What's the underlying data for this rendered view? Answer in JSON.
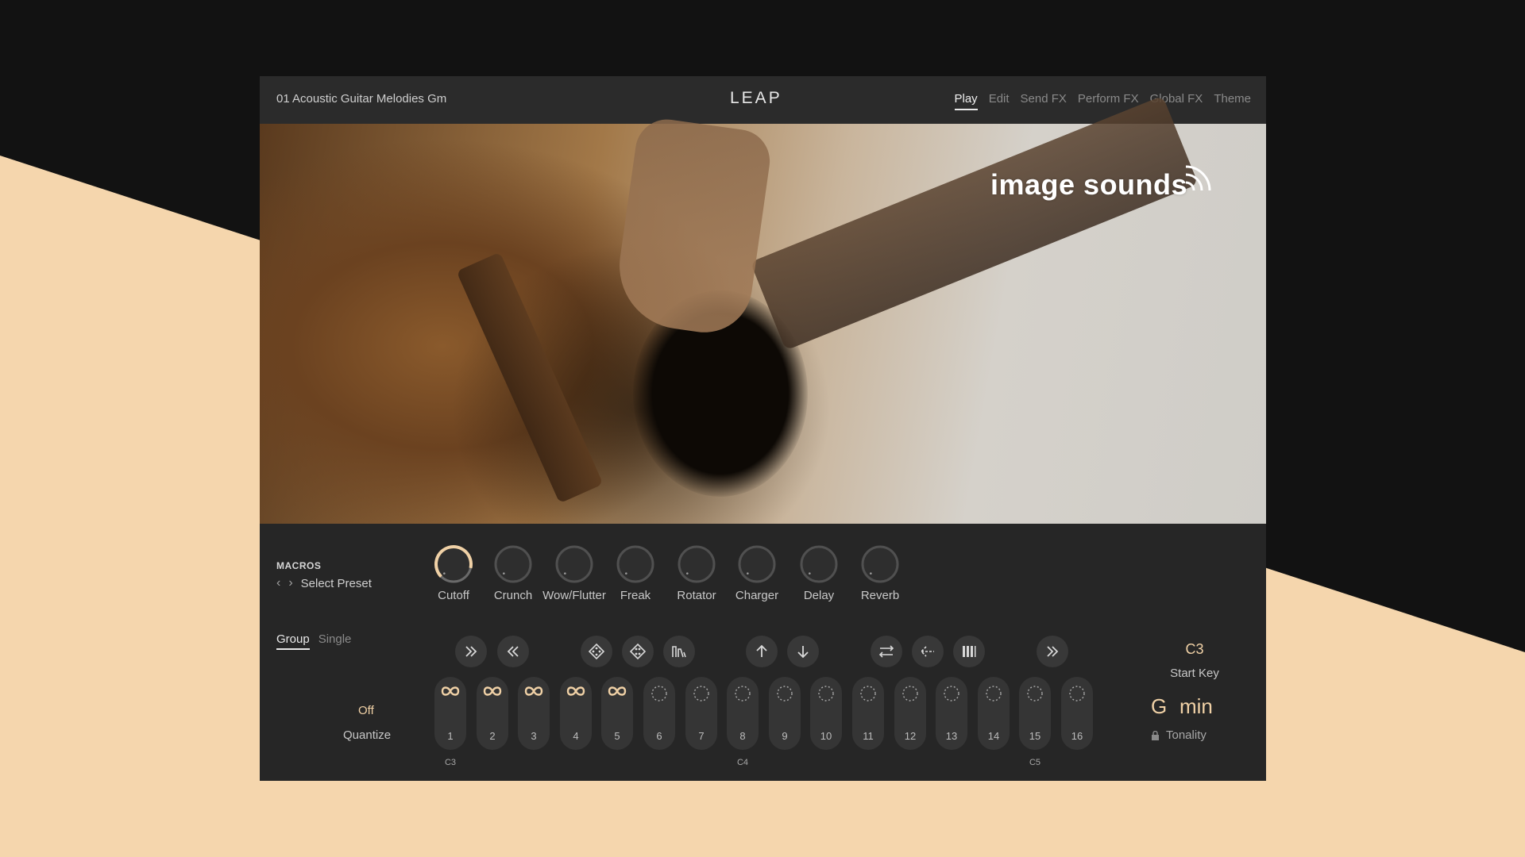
{
  "header": {
    "preset_name": "01 Acoustic Guitar Melodies Gm",
    "logo": "LEAP",
    "tabs": [
      {
        "label": "Play",
        "active": true
      },
      {
        "label": "Edit",
        "active": false
      },
      {
        "label": "Send FX",
        "active": false
      },
      {
        "label": "Perform FX",
        "active": false
      },
      {
        "label": "Global FX",
        "active": false
      },
      {
        "label": "Theme",
        "active": false
      }
    ]
  },
  "hero": {
    "brand": "image sounds"
  },
  "macros": {
    "title": "MACROS",
    "preset_label": "Select Preset",
    "knobs": [
      {
        "label": "Cutoff",
        "value": 0.88
      },
      {
        "label": "Crunch",
        "value": 0.0
      },
      {
        "label": "Wow/Flutter",
        "value": 0.0
      },
      {
        "label": "Freak",
        "value": 0.0
      },
      {
        "label": "Rotator",
        "value": 0.0
      },
      {
        "label": "Charger",
        "value": 0.0
      },
      {
        "label": "Delay",
        "value": 0.0
      },
      {
        "label": "Reverb",
        "value": 0.0
      }
    ]
  },
  "mode_tabs": [
    {
      "label": "Group",
      "active": true
    },
    {
      "label": "Single",
      "active": false
    }
  ],
  "quantize": {
    "value": "Off",
    "label": "Quantize"
  },
  "tools": [
    {
      "name": "fast-forward-icon"
    },
    {
      "name": "rewind-icon"
    },
    {
      "name": "dice-icon"
    },
    {
      "name": "dice-alt-icon"
    },
    {
      "name": "waveform-icon"
    },
    {
      "name": "arrow-up-icon"
    },
    {
      "name": "arrow-down-icon"
    },
    {
      "name": "swap-icon"
    },
    {
      "name": "reverse-icon"
    },
    {
      "name": "bars-icon"
    },
    {
      "name": "skip-forward-icon"
    }
  ],
  "pads": [
    {
      "num": "1",
      "state": "loop"
    },
    {
      "num": "2",
      "state": "loop"
    },
    {
      "num": "3",
      "state": "loop"
    },
    {
      "num": "4",
      "state": "loop"
    },
    {
      "num": "5",
      "state": "loop"
    },
    {
      "num": "6",
      "state": "empty"
    },
    {
      "num": "7",
      "state": "empty"
    },
    {
      "num": "8",
      "state": "empty"
    },
    {
      "num": "9",
      "state": "empty"
    },
    {
      "num": "10",
      "state": "empty"
    },
    {
      "num": "11",
      "state": "empty"
    },
    {
      "num": "12",
      "state": "empty"
    },
    {
      "num": "13",
      "state": "empty"
    },
    {
      "num": "14",
      "state": "empty"
    },
    {
      "num": "15",
      "state": "empty"
    },
    {
      "num": "16",
      "state": "empty"
    }
  ],
  "key_labels": [
    {
      "label": "C3",
      "pad": "1"
    },
    {
      "label": "C4",
      "pad": "8"
    },
    {
      "label": "C5",
      "pad": "15"
    }
  ],
  "start_key": {
    "value": "C3",
    "label": "Start Key"
  },
  "tonality": {
    "key": "G",
    "mode": "min",
    "label": "Tonality"
  },
  "colors": {
    "accent": "#f0d1a6",
    "panel": "#262626",
    "header": "#2b2b2b",
    "beige_bg": "#f5d6ad"
  }
}
